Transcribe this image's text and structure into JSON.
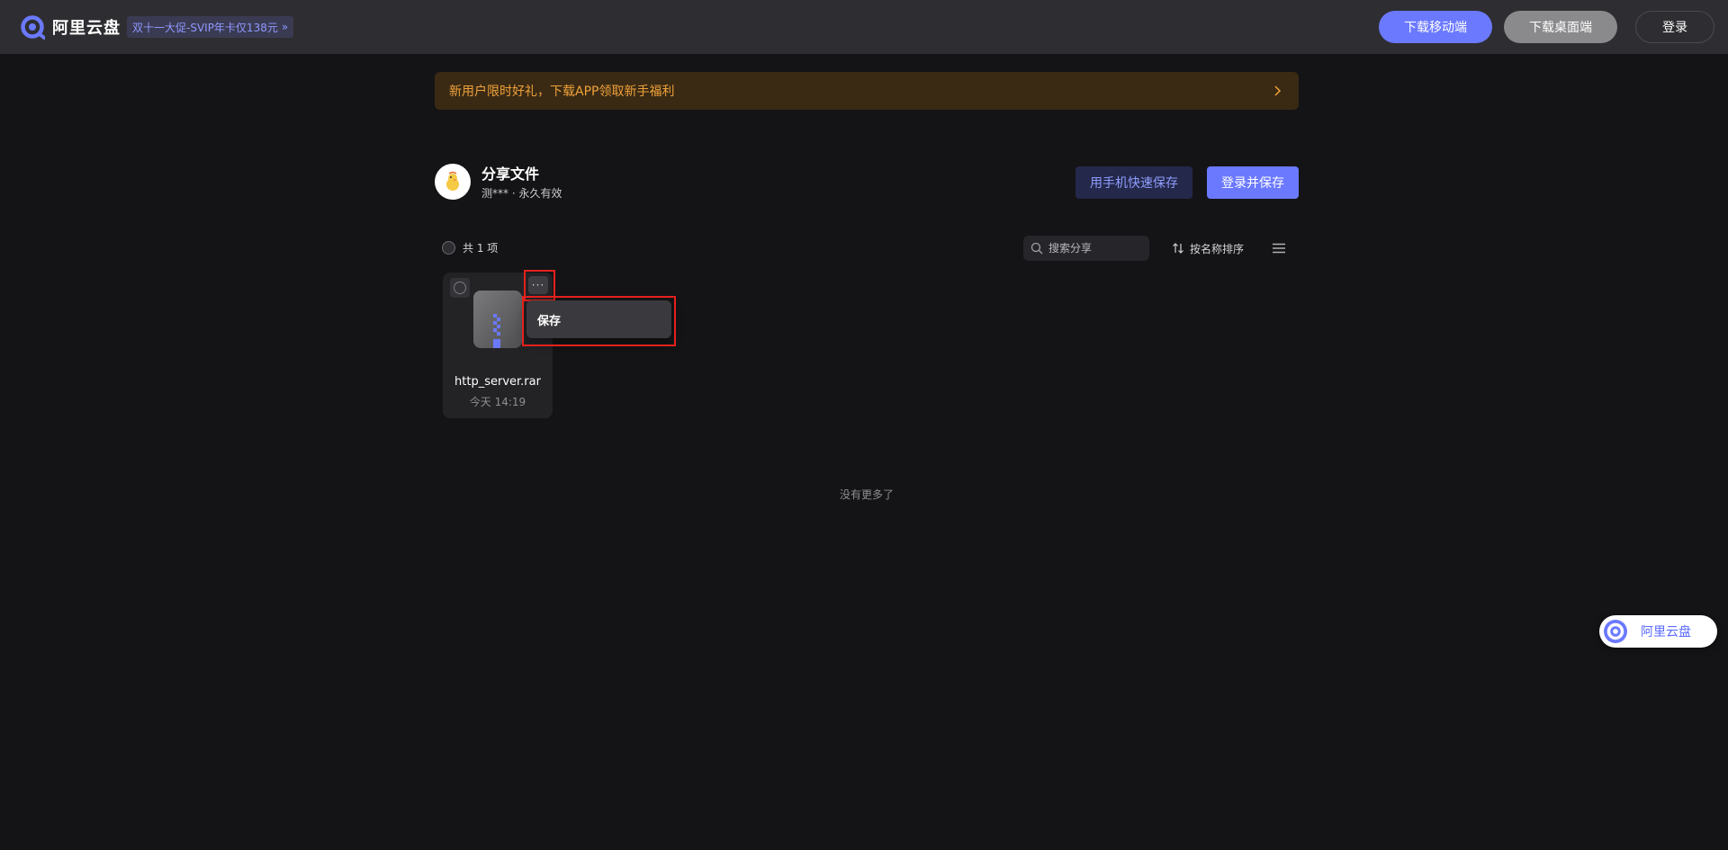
{
  "header": {
    "logo_text": "阿里云盘",
    "promo_text": "双十一大促-SVIP年卡仅138元",
    "promo_arrow": "»",
    "download_mobile": "下载移动端",
    "download_desktop": "下载桌面端",
    "login": "登录"
  },
  "banner": {
    "text": "新用户限时好礼，下载APP领取新手福利"
  },
  "share": {
    "title": "分享文件",
    "subtitle": "测*** · 永久有效",
    "phone_save": "用手机快速保存",
    "login_save": "登录并保存"
  },
  "toolbar": {
    "item_count": "共 1 项",
    "search_placeholder": "搜索分享",
    "sort_label": "按名称排序"
  },
  "files": [
    {
      "name": "http_server.rar",
      "time": "今天 14:19",
      "more_label": "···"
    }
  ],
  "context_menu": {
    "items": [
      {
        "label": "保存"
      }
    ]
  },
  "footer": {
    "no_more": "没有更多了"
  },
  "float_badge": {
    "text": "阿里云盘"
  },
  "colors": {
    "accent": "#6b79ff",
    "background": "#141416",
    "header": "#2e2e32",
    "highlight": "#e4211c",
    "banner_text": "#f0a23a"
  }
}
